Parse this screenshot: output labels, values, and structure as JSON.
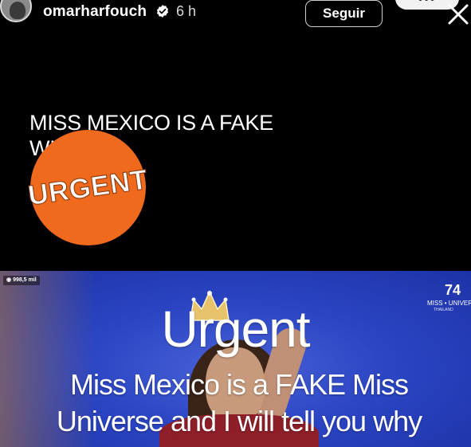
{
  "header": {
    "username": "omarharfouch",
    "time": "6 h",
    "follow_label": "Seguir",
    "more_label": "•••",
    "icons": {
      "avatar": "profile-avatar",
      "verified": "verified-badge-icon",
      "close": "close-icon"
    }
  },
  "post": {
    "headline": "MISS MEXICO IS A FAKE WINNER",
    "badge_label": "URGENT",
    "badge_color": "#f06a1d"
  },
  "video": {
    "views": "998,5 mil",
    "logo_mark": "74",
    "logo_text": "MISS • UNIVERSE",
    "logo_sub": "THAILAND",
    "title": "Urgent",
    "subtitle": "Miss Mexico is a FAKE Miss Universe and I will tell you why",
    "background_color": "#2b45c4"
  }
}
